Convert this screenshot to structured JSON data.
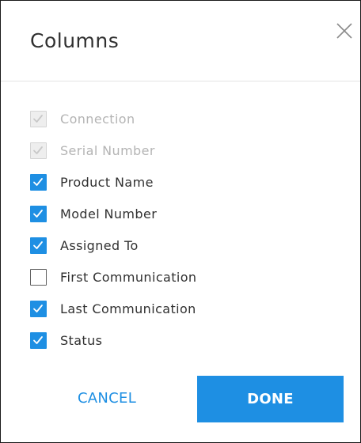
{
  "dialog": {
    "title": "Columns",
    "close_icon": "close-icon"
  },
  "columns": [
    {
      "label": "Connection",
      "checked": true,
      "disabled": true
    },
    {
      "label": "Serial Number",
      "checked": true,
      "disabled": true
    },
    {
      "label": "Product Name",
      "checked": true,
      "disabled": false
    },
    {
      "label": "Model Number",
      "checked": true,
      "disabled": false
    },
    {
      "label": "Assigned To",
      "checked": true,
      "disabled": false
    },
    {
      "label": "First Communication",
      "checked": false,
      "disabled": false
    },
    {
      "label": "Last Communication",
      "checked": true,
      "disabled": false
    },
    {
      "label": "Status",
      "checked": true,
      "disabled": false
    }
  ],
  "actions": {
    "cancel_label": "CANCEL",
    "done_label": "DONE"
  },
  "colors": {
    "accent": "#1e8fe3",
    "disabled_text": "#b4b4b4",
    "text": "#303030"
  }
}
